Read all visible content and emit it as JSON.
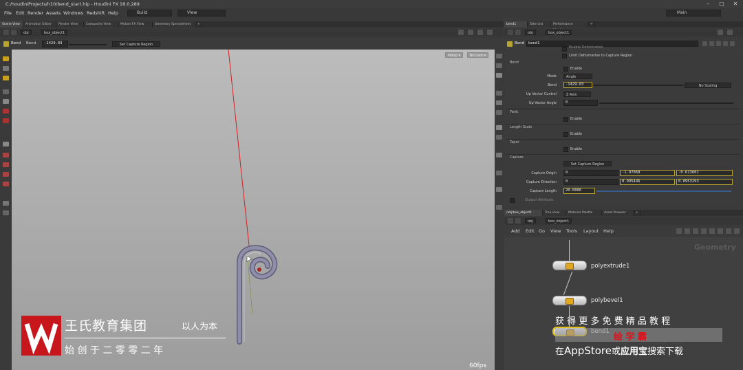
{
  "window": {
    "title": "C:/houdiniProjects/h10/bend_start.hip - Houdini FX 18.0.289"
  },
  "menu": {
    "items": [
      "File",
      "Edit",
      "Render",
      "Assets",
      "Windows",
      "Redshift",
      "Help"
    ]
  },
  "toolbar": {
    "desktop": "Build",
    "view": "View",
    "layout": "Main"
  },
  "left_tabs": [
    "Scene View",
    "Animation Editor",
    "Render View",
    "Composite View",
    "Motion FX View",
    "Geometry Spreadsheet"
  ],
  "right_top_tabs": [
    "bend1",
    "Take List",
    "Performance Monitor"
  ],
  "right_bottom_tabs": [
    "/obj/box_object1",
    "Tree View",
    "Material Palette",
    "Asset Browser"
  ],
  "path": {
    "root": "obj",
    "object": "box_object1"
  },
  "viewport": {
    "tool_label": "Bend",
    "tool_name": "Bend",
    "bend_value": "-1429.03",
    "set_capture": "Set Capture Region",
    "persp": "Persp ▾",
    "nocam": "No cam ▾",
    "fps": "60fps"
  },
  "params": {
    "node_type": "Bend",
    "node_name": "bend1",
    "enable_deform": "Enable Deformation",
    "limit_deform": "Limit Deformation to Capture Region",
    "bend_section": "Bend",
    "enable": "Enable",
    "mode_label": "Mode",
    "mode_value": "Angle",
    "bend_label": "Bend",
    "bend_value": "-1429.03",
    "no_scaling": "No Scaling",
    "upvec_label": "Up Vector Control",
    "upvec_value": "Z Axis",
    "upangle_label": "Up Vector Angle",
    "upangle_value": "0",
    "twist_section": "Twist",
    "length_section": "Length Scale",
    "taper_section": "Taper",
    "capture_section": "Capture",
    "set_capture_btn": "Set Capture Region",
    "origin_label": "Capture Origin",
    "origin": [
      "0",
      "-1.97068",
      "-0.613601"
    ],
    "direction_label": "Capture Direction",
    "direction": [
      "0",
      "0.995446",
      "0.0953293"
    ],
    "length_label": "Capture Length",
    "length_value": "20.0006",
    "output_attr": "Output Attribute"
  },
  "network": {
    "menu": [
      "Add",
      "Edit",
      "Go",
      "View",
      "Tools",
      "Layout",
      "Help"
    ],
    "context_label": "Geometry",
    "nodes": [
      "polyextrude1",
      "polybevel1",
      "bend1"
    ]
  },
  "watermark": {
    "brand": "王氏教育集团",
    "motto": "以人为本",
    "since": "始 创 于 二 零 零 二 年",
    "promo1": "获 得 更 多 免 费 精 品 教 程",
    "promo_brand": "绘 学 霸",
    "promo2_a": "在",
    "promo2_b": "AppStore",
    "promo2_c": "或",
    "promo2_d": "应用宝",
    "promo2_e": "搜索下载"
  },
  "colors": {
    "accent": "#b8a432",
    "node_bg": "#e6e6e6",
    "watermark_red": "#c8161d"
  }
}
